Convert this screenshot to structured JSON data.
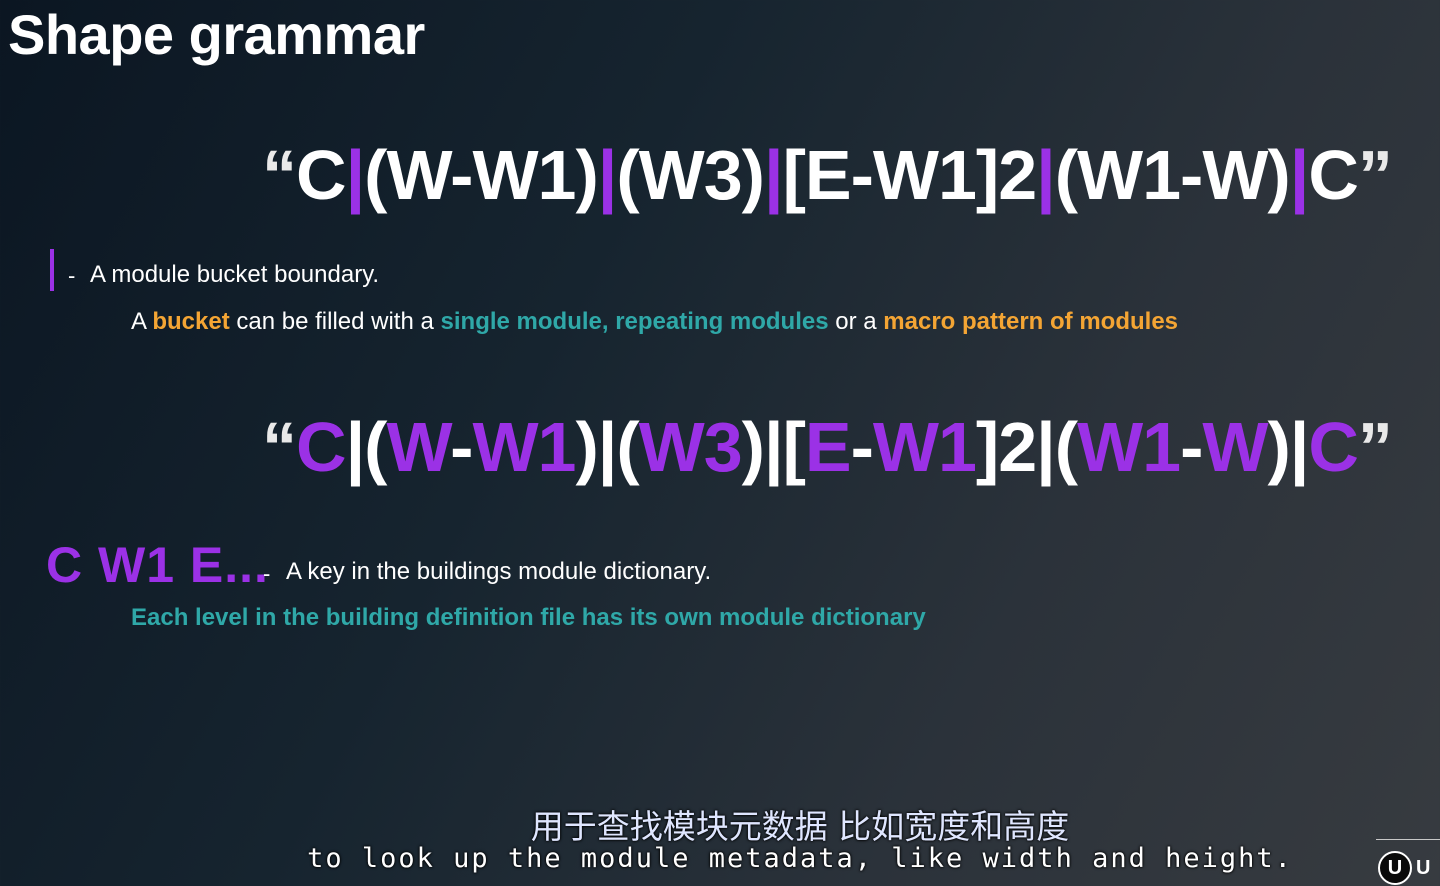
{
  "title": "Shape grammar",
  "grammar1": {
    "open_quote": "“",
    "close_quote": "”",
    "tokens": [
      {
        "t": "C",
        "c": "#ffffff"
      },
      {
        "t": "|",
        "c": "#9b31e6"
      },
      {
        "t": "(W-W1)",
        "c": "#ffffff"
      },
      {
        "t": "|",
        "c": "#9b31e6"
      },
      {
        "t": "(W3)",
        "c": "#ffffff"
      },
      {
        "t": "|",
        "c": "#9b31e6"
      },
      {
        "t": "[E-W1]2",
        "c": "#ffffff"
      },
      {
        "t": "|",
        "c": "#9b31e6"
      },
      {
        "t": "(W1-W)",
        "c": "#ffffff"
      },
      {
        "t": "|",
        "c": "#9b31e6"
      },
      {
        "t": "C",
        "c": "#ffffff"
      }
    ]
  },
  "pipe_note": {
    "dash": "-",
    "text": "A module bucket boundary.",
    "sub": {
      "p1": "A ",
      "p2": "bucket",
      "p3": " can be filled with a ",
      "p4": "single module, repeating modules",
      "p5": " or a ",
      "p6": "macro pattern of modules"
    }
  },
  "grammar2": {
    "open_quote": "“",
    "close_quote": "”",
    "tokens": [
      {
        "t": "C",
        "c": "#9b31e6"
      },
      {
        "t": "|",
        "c": "#ffffff"
      },
      {
        "t": "(",
        "c": "#ffffff"
      },
      {
        "t": "W",
        "c": "#9b31e6"
      },
      {
        "t": "-",
        "c": "#ffffff"
      },
      {
        "t": "W1",
        "c": "#9b31e6"
      },
      {
        "t": ")",
        "c": "#ffffff"
      },
      {
        "t": "|",
        "c": "#ffffff"
      },
      {
        "t": "(",
        "c": "#ffffff"
      },
      {
        "t": "W3",
        "c": "#9b31e6"
      },
      {
        "t": ")",
        "c": "#ffffff"
      },
      {
        "t": "|",
        "c": "#ffffff"
      },
      {
        "t": "[",
        "c": "#ffffff"
      },
      {
        "t": "E",
        "c": "#9b31e6"
      },
      {
        "t": "-",
        "c": "#ffffff"
      },
      {
        "t": "W1",
        "c": "#9b31e6"
      },
      {
        "t": "]2",
        "c": "#ffffff"
      },
      {
        "t": "|",
        "c": "#ffffff"
      },
      {
        "t": "(",
        "c": "#ffffff"
      },
      {
        "t": "W1",
        "c": "#9b31e6"
      },
      {
        "t": "-",
        "c": "#ffffff"
      },
      {
        "t": "W",
        "c": "#9b31e6"
      },
      {
        "t": ")",
        "c": "#ffffff"
      },
      {
        "t": "|",
        "c": "#ffffff"
      },
      {
        "t": "C",
        "c": "#9b31e6"
      }
    ]
  },
  "key_note": {
    "keys": "C W1 E...",
    "dash": "-",
    "text": "A key in the buildings module dictionary.",
    "sub": "Each level in the building definition file has its own module dictionary"
  },
  "subtitles": {
    "cn": "用于查找模块元数据 比如宽度和高度",
    "en": "to look up the module metadata, like width and height."
  },
  "logo": {
    "icon": "unreal-engine-logo-icon",
    "mark": "U",
    "text": "U"
  },
  "colors": {
    "accent_purple": "#9b31e6",
    "accent_orange": "#f4a534",
    "accent_teal": "#2fa8a8"
  }
}
